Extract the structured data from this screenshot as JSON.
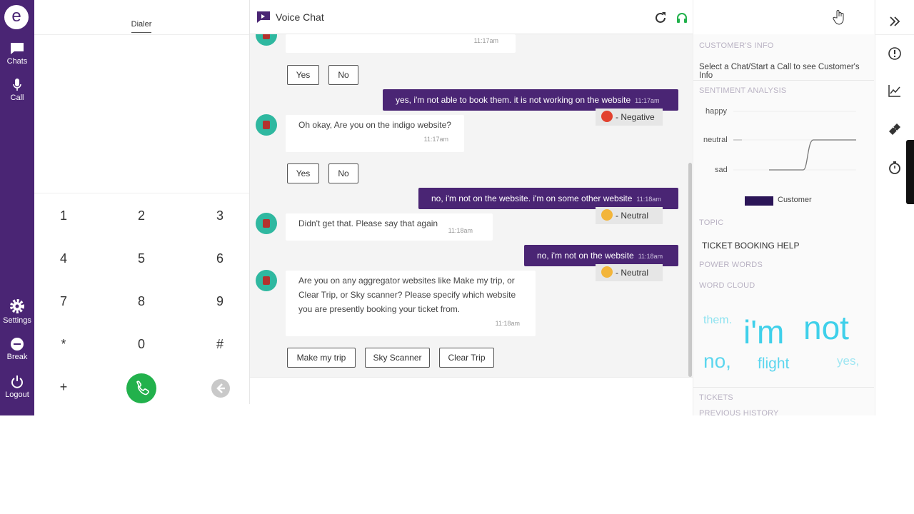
{
  "nav": {
    "logo": "e",
    "chats_label": "Chats",
    "call_label": "Call",
    "settings_label": "Settings",
    "break_label": "Break",
    "logout_label": "Logout"
  },
  "dialer": {
    "tab_label": "Dialer",
    "keys": [
      "1",
      "2",
      "3",
      "4",
      "5",
      "6",
      "7",
      "8",
      "9",
      "*",
      "0",
      "#",
      "+"
    ]
  },
  "chat": {
    "title": "Voice Chat",
    "top_time": "11:17am",
    "messages": [
      {
        "text": "yes, i'm not able to book them. it is not working on the website",
        "time": "11:17am",
        "sentiment": "- Negative"
      },
      {
        "text": "Oh okay, Are you on the indigo website?",
        "time": "11:17am"
      },
      {
        "text": "no, i'm not on the website. i'm on some other website",
        "time": "11:18am",
        "sentiment": "- Neutral"
      },
      {
        "text": "Didn't get that. Please say that again",
        "time": "11:18am"
      },
      {
        "text": "no, i'm not on the website",
        "time": "11:18am",
        "sentiment": "- Neutral"
      },
      {
        "text": "Are you on any aggregator websites like Make my trip, or Clear Trip, or Sky scanner? Please specify which website you are presently booking your ticket from.",
        "time": "11:18am"
      }
    ],
    "yes_label": "Yes",
    "no_label": "No",
    "options": [
      "Make my trip",
      "Sky Scanner",
      "Clear Trip"
    ]
  },
  "panel": {
    "customers_info_title": "CUSTOMER'S INFO",
    "customers_info_text": "Select a Chat/Start a Call to see Customer's Info",
    "sentiment_title": "SENTIMENT ANALYSIS",
    "sentiment_levels": [
      "happy",
      "neutral",
      "sad"
    ],
    "legend_label": "Customer",
    "topic_title": "TOPIC",
    "topic_value": "TICKET BOOKING HELP",
    "power_words_title": "POWER WORDS",
    "word_cloud_title": "WORD CLOUD",
    "word_cloud": [
      "them.",
      "i'm",
      "not",
      "no,",
      "flight",
      "yes,"
    ],
    "tickets_title": "TICKETS",
    "previous_history_title": "PREVIOUS HISTORY"
  },
  "colors": {
    "brand": "#4a2574",
    "call_green": "#22b14c",
    "word_cloud": "#3fd0ea"
  }
}
